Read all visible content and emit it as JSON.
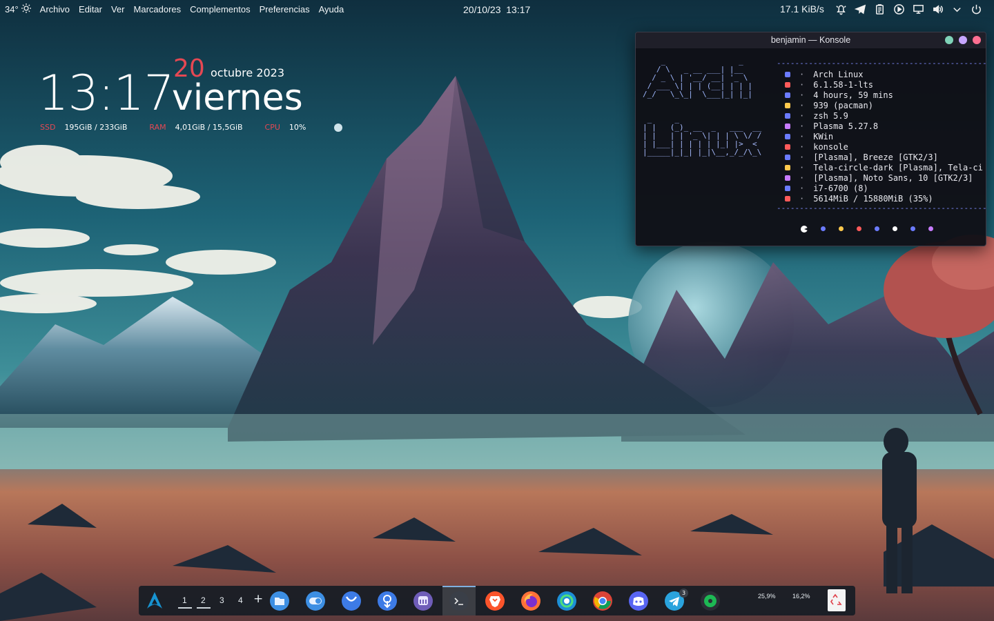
{
  "topbar": {
    "temperature": "34°",
    "weather_icon": "sun-icon",
    "menu": [
      "Archivo",
      "Editar",
      "Ver",
      "Marcadores",
      "Complementos",
      "Preferencias",
      "Ayuda"
    ],
    "datetime": "20/10/23  13:17",
    "netspeed": "17.1 KiB/s",
    "tray_icons": [
      "bell-icon",
      "telegram-icon",
      "clipboard-icon",
      "media-play-icon",
      "network-icon",
      "volume-icon",
      "chevron-down-icon",
      "power-icon"
    ]
  },
  "clock": {
    "time": "13:17",
    "day": "20",
    "month_year": "octubre 2023",
    "weekday": "viernes",
    "stats": [
      {
        "label": "SSD",
        "value": "195GiB / 233GiB"
      },
      {
        "label": "RAM",
        "value": "4,01GiB / 15,5GiB"
      },
      {
        "label": "CPU",
        "value": "10%"
      }
    ]
  },
  "konsole": {
    "title": "benjamin — Konsole",
    "buttons": {
      "minimize": "#7fd3b8",
      "maximize": "#c7a6ff",
      "close": "#ff6f91"
    },
    "ascii_arch": [
      "    _                _     ",
      "   / \\   _ __ ___| |__  ",
      "  / _ \\ | '__/ __| '_ \\ ",
      " / ___ \\| | | (__| | | |",
      "/_/   \\_\\_|  \\___|_| |_|"
    ],
    "ascii_linux": [
      " _     _                   ",
      "| |   (_)_ __  _   ___  __",
      "| |   | | '_ \\| | | \\ \\/ /",
      "| |___| | | | | |_| |>  < ",
      "|_____|_|_| |_|\\__,_/_/\\_\\"
    ],
    "separator": "-------------------------------------------------------",
    "info": [
      {
        "icon": "arch-icon",
        "color": "#6b7bff",
        "text": "Arch Linux"
      },
      {
        "icon": "kernel-icon",
        "color": "#ff5a5a",
        "text": "6.1.58-1-lts"
      },
      {
        "icon": "clock-icon",
        "color": "#6b7bff",
        "text": "4 hours, 59 mins"
      },
      {
        "icon": "package-icon",
        "color": "#ffc94d",
        "text": "939 (pacman)"
      },
      {
        "icon": "terminal-icon",
        "color": "#6b7bff",
        "text": "zsh 5.9"
      },
      {
        "icon": "desktop-icon",
        "color": "#c77bff",
        "text": "Plasma 5.27.8"
      },
      {
        "icon": "window-icon",
        "color": "#6b7bff",
        "text": "KWin"
      },
      {
        "icon": "konsole-icon",
        "color": "#ff5a5a",
        "text": "konsole"
      },
      {
        "icon": "brush-icon",
        "color": "#6b7bff",
        "text": "[Plasma], Breeze [GTK2/3]"
      },
      {
        "icon": "grid-icon",
        "color": "#ffc94d",
        "text": "Tela-circle-dark [Plasma], Tela-ci"
      },
      {
        "icon": "font-icon",
        "color": "#c77bff",
        "text": "[Plasma], Noto Sans, 10 [GTK2/3]"
      },
      {
        "icon": "cpu-icon",
        "color": "#6b7bff",
        "text": "i7-6700 (8)"
      },
      {
        "icon": "memory-icon",
        "color": "#ff5a5a",
        "text": "5614MiB / 15880MiB (35%)"
      }
    ],
    "palette": [
      "#ffffff",
      "#6b7bff",
      "#ffc94d",
      "#ff5a5a",
      "#6b7bff",
      "#ffffff",
      "#6b7bff",
      "#c77bff"
    ]
  },
  "dock": {
    "launcher_icon": "arch-logo-icon",
    "workspaces": [
      "1",
      "2",
      "3",
      "4"
    ],
    "add_workspace": "+",
    "apps": [
      "files-icon",
      "toggle-icon",
      "github-icon",
      "downloader-icon",
      "mastodon-icon",
      "terminal-icon",
      "brave-icon",
      "firefox-icon",
      "edge-icon",
      "chrome-icon",
      "discord-icon",
      "telegram-icon",
      "spotify-icon"
    ],
    "telegram_badge": "3",
    "gauge_1": "25,9%",
    "gauge_2": "16,2%",
    "trash_icon": "trash-icon"
  }
}
